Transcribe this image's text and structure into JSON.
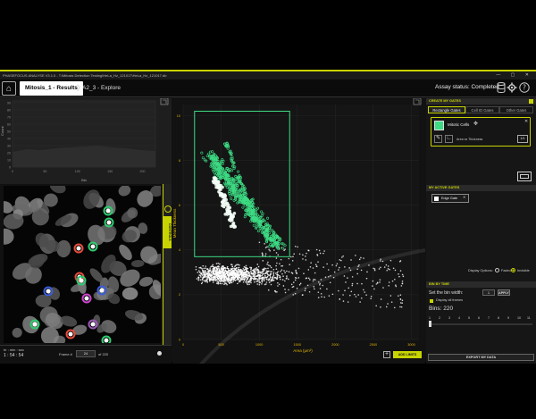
{
  "window": {
    "title": "PHASEFOCUS ANALYSE V3.1.0 - T:\\Mitosis Detection Testing\\HeLa_Hz_121017\\HeLa_Hz_121017.db",
    "controls": "— ▢ ✕"
  },
  "nav": {
    "home_icon": "⌂",
    "breadcrumb_active": "Mitosis_1 - Results",
    "breadcrumb_current": "A2_3 - Explore",
    "sep": "❯",
    "assay_status": "Assay status: Completed",
    "icons": [
      "database-icon",
      "gear-icon",
      "help-icon"
    ]
  },
  "histogram": {
    "ylabel": "Count",
    "xlabel": "Bin",
    "y_ticks": [
      "90",
      "80",
      "70",
      "60",
      "50",
      "40",
      "30",
      "20",
      "10",
      "0"
    ],
    "x_ticks": [
      "0",
      "50",
      "100",
      "150",
      "200"
    ]
  },
  "toggle_label": "CONTROLS",
  "framebar": {
    "time_label": "hr : min : sec",
    "time_value": "1 : 54 : 54",
    "frame_label": "Frame #",
    "frame_value": "24",
    "frame_total": "of 220"
  },
  "scatter": {
    "xlabel": "Area (μm²)",
    "ylabel": "Mean Thickness",
    "x_ticks": [
      "0",
      "500",
      "1000",
      "1500",
      "2000",
      "2500",
      "3000"
    ],
    "y_ticks": [
      "10",
      "8",
      "6",
      "4",
      "2",
      "0"
    ],
    "add_limits_label": "ADD LIMITS",
    "add_icon": "+"
  },
  "chart_data": {
    "type": "scatter",
    "title": "",
    "xlabel": "Area (μm²)",
    "ylabel": "Mean Thickness",
    "xlim": [
      0,
      3100
    ],
    "ylim": [
      0,
      10.5
    ],
    "series": [
      {
        "name": "Mitotic Cells",
        "color": "#3ddc84",
        "description_cluster": {
          "x_range": [
            300,
            1400
          ],
          "y_range": [
            3.7,
            8.9
          ]
        }
      },
      {
        "name": "",
        "color": "#ffffff",
        "description_cluster": {
          "x_range": [
            100,
            2950
          ],
          "y_range": [
            1.8,
            4.3
          ]
        }
      }
    ],
    "gate": {
      "x": [
        150,
        1400
      ],
      "y": [
        3.7,
        10.2
      ],
      "color": "#3ddc84"
    },
    "grid": true
  },
  "right_panel": {
    "create_head": "CREATE MY GATES",
    "tabs": [
      "Rectangle Gates",
      "Cell ID Gates",
      "Other Gates"
    ],
    "gate_name": "Mitotic Cells",
    "gate_axes": "Area vs Thickness",
    "gate_id": "1/1",
    "active_head": "MY ACTIVE GATES",
    "active_item": "Edge Gate",
    "display_options_label": "Display Options:",
    "opt_faded": "Faded",
    "opt_invisible": "Invisible",
    "bin_head": "BIN BY TIME",
    "bin_width_label": "Set the bin width:",
    "bin_width_value": "1",
    "apply_label": "APPLY",
    "display_all_label": "Display all frames",
    "bins_label": "Bins: 220",
    "bin_ticks": [
      "1",
      "2",
      "3",
      "4",
      "5",
      "6",
      "7",
      "8",
      "9",
      "10",
      "11"
    ],
    "export_label": "EXPORT MY DATA"
  },
  "colors": {
    "accent": "#c8d400",
    "gate": "#3ddc84"
  }
}
